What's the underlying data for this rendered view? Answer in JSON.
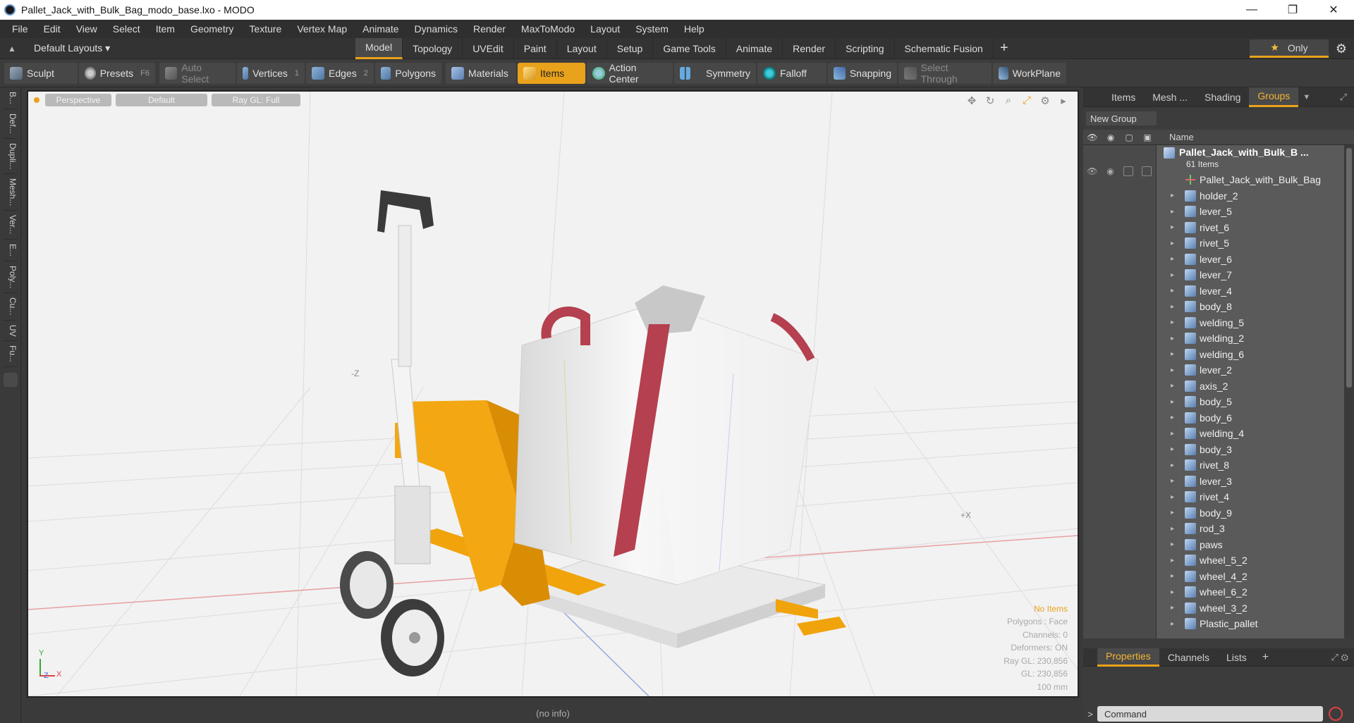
{
  "window": {
    "title": "Pallet_Jack_with_Bulk_Bag_modo_base.lxo - MODO",
    "minimize": "—",
    "restore": "❐",
    "close": "✕"
  },
  "menu": [
    "File",
    "Edit",
    "View",
    "Select",
    "Item",
    "Geometry",
    "Texture",
    "Vertex Map",
    "Animate",
    "Dynamics",
    "Render",
    "MaxToModo",
    "Layout",
    "System",
    "Help"
  ],
  "layout_bar": {
    "layouts_label": "Default Layouts ▾",
    "tabs": [
      "Model",
      "Topology",
      "UVEdit",
      "Paint",
      "Layout",
      "Setup",
      "Game Tools",
      "Animate",
      "Render",
      "Scripting",
      "Schematic Fusion"
    ],
    "active_tab": "Model",
    "plus": "+",
    "only_label": "Only",
    "only_star": "★"
  },
  "toolbar": {
    "sculpt": "Sculpt",
    "presets": "Presets",
    "presets_key": "F6",
    "auto_select": "Auto Select",
    "vertices": "Vertices",
    "vertices_key": "1",
    "edges": "Edges",
    "edges_key": "2",
    "polygons": "Polygons",
    "materials": "Materials",
    "items": "Items",
    "action_center": "Action Center",
    "symmetry": "Symmetry",
    "falloff": "Falloff",
    "snapping": "Snapping",
    "select_through": "Select Through",
    "workplane": "WorkPlane"
  },
  "left_tabs": [
    "B...",
    "Def...",
    "Dupli...",
    "Mesh...",
    "Ver...",
    "E...",
    "Poly...",
    "Cu...",
    "UV",
    "Fu..."
  ],
  "viewport": {
    "view_mode": "Perspective",
    "shading": "Default",
    "raygl": "Ray GL: Full",
    "axis_neg_z": "-Z",
    "axis_pos_x": "+X",
    "gizmo_x": "X",
    "gizmo_y": "Y",
    "gizmo_z": "Z",
    "stats": {
      "no_items": "No Items",
      "polygons": "Polygons : Face",
      "channels": "Channels: 0",
      "deformers": "Deformers: ON",
      "raygl": "Ray GL: 230,856",
      "gl": "GL: 230,856",
      "scale": "100 mm"
    }
  },
  "status_line": "(no info)",
  "right_panel": {
    "tabs": [
      "Items",
      "Mesh ...",
      "Shading",
      "Groups"
    ],
    "active_tab": "Groups",
    "new_group": "New Group",
    "name_header": "Name",
    "root_name": "Pallet_Jack_with_Bulk_B ...",
    "root_count": "61 Items",
    "items": [
      "Pallet_Jack_with_Bulk_Bag",
      "holder_2",
      "lever_5",
      "rivet_6",
      "rivet_5",
      "lever_6",
      "lever_7",
      "lever_4",
      "body_8",
      "welding_5",
      "welding_2",
      "welding_6",
      "lever_2",
      "axis_2",
      "body_5",
      "body_6",
      "welding_4",
      "body_3",
      "rivet_8",
      "lever_3",
      "rivet_4",
      "body_9",
      "rod_3",
      "paws",
      "wheel_5_2",
      "wheel_4_2",
      "wheel_6_2",
      "wheel_3_2",
      "Plastic_pallet"
    ],
    "props_tabs": [
      "Properties",
      "Channels",
      "Lists"
    ],
    "active_props_tab": "Properties",
    "command_placeholder": "Command",
    "prompt": ">"
  }
}
